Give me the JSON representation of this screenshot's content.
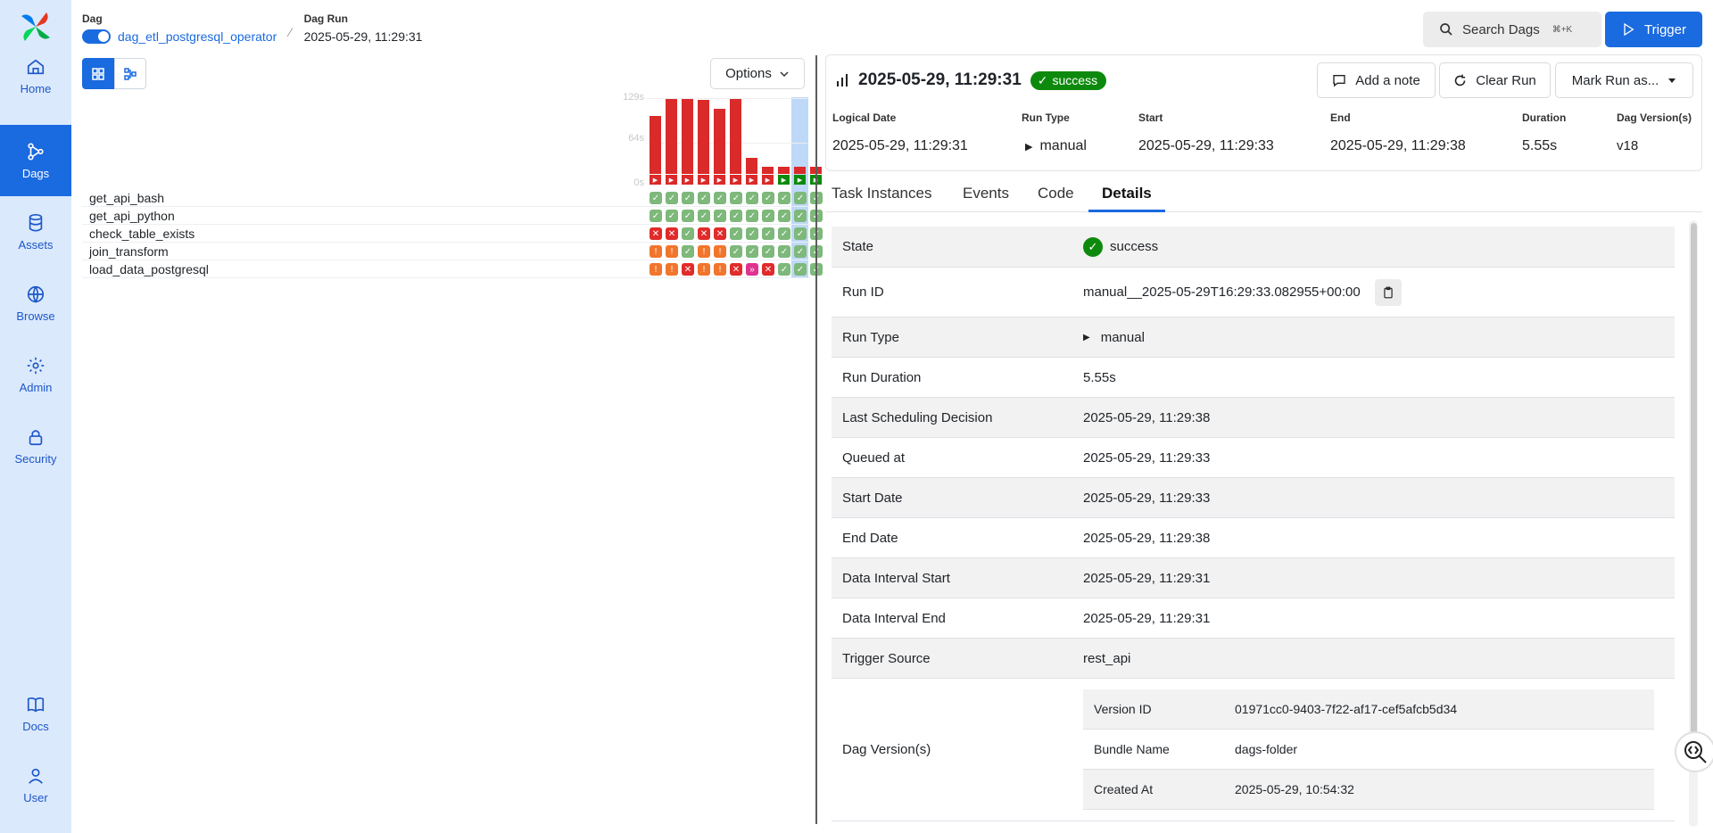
{
  "sidebar": {
    "items": [
      {
        "label": "Home"
      },
      {
        "label": "Dags"
      },
      {
        "label": "Assets"
      },
      {
        "label": "Browse"
      },
      {
        "label": "Admin"
      },
      {
        "label": "Security"
      },
      {
        "label": "Docs"
      },
      {
        "label": "User"
      }
    ]
  },
  "header": {
    "dag_label": "Dag",
    "dag_name": "dag_etl_postgresql_operator",
    "dagrun_label": "Dag Run",
    "dagrun_value": "2025-05-29, 11:29:31",
    "search_label": "Search Dags",
    "search_shortcut": "⌘+K",
    "trigger_label": "Trigger"
  },
  "grid": {
    "options_label": "Options",
    "y_ticks": [
      "129s",
      "64s",
      "0s"
    ],
    "run_durations_s": [
      98,
      127,
      128,
      126,
      111,
      127,
      27,
      12,
      12,
      12,
      12
    ],
    "run_states": [
      "failed",
      "failed",
      "failed",
      "failed",
      "failed",
      "failed",
      "failed",
      "failed",
      "success",
      "success",
      "success"
    ],
    "tasks": [
      {
        "name": "get_api_bash",
        "states": [
          "s",
          "s",
          "s",
          "s",
          "s",
          "s",
          "s",
          "s",
          "s",
          "s",
          "s"
        ]
      },
      {
        "name": "get_api_python",
        "states": [
          "s",
          "s",
          "s",
          "s",
          "s",
          "s",
          "s",
          "s",
          "s",
          "s",
          "s"
        ]
      },
      {
        "name": "check_table_exists",
        "states": [
          "f",
          "f",
          "s",
          "f",
          "f",
          "s",
          "s",
          "s",
          "s",
          "s",
          "s"
        ]
      },
      {
        "name": "join_transform",
        "states": [
          "u",
          "u",
          "s",
          "u",
          "u",
          "s",
          "s",
          "s",
          "s",
          "s",
          "s"
        ]
      },
      {
        "name": "load_data_postgresql",
        "states": [
          "u",
          "u",
          "f",
          "u",
          "u",
          "f",
          "k",
          "f",
          "s",
          "s",
          "s"
        ]
      }
    ]
  },
  "run": {
    "title": "2025-05-29, 11:29:31",
    "state": "success",
    "add_note_label": "Add a note",
    "clear_run_label": "Clear Run",
    "mark_run_label": "Mark Run as...",
    "meta": [
      {
        "label": "Logical Date",
        "value": "2025-05-29, 11:29:31"
      },
      {
        "label": "Run Type",
        "value": "manual"
      },
      {
        "label": "Start",
        "value": "2025-05-29, 11:29:33"
      },
      {
        "label": "End",
        "value": "2025-05-29, 11:29:38"
      },
      {
        "label": "Duration",
        "value": "5.55s"
      },
      {
        "label": "Dag Version(s)",
        "value": "v18"
      }
    ]
  },
  "tabs": [
    {
      "label": "Task Instances"
    },
    {
      "label": "Events"
    },
    {
      "label": "Code"
    },
    {
      "label": "Details"
    }
  ],
  "details": {
    "rows": [
      {
        "key": "State",
        "value": "success"
      },
      {
        "key": "Run ID",
        "value": "manual__2025-05-29T16:29:33.082955+00:00"
      },
      {
        "key": "Run Type",
        "value": "manual"
      },
      {
        "key": "Run Duration",
        "value": "5.55s"
      },
      {
        "key": "Last Scheduling Decision",
        "value": "2025-05-29, 11:29:38"
      },
      {
        "key": "Queued at",
        "value": "2025-05-29, 11:29:33"
      },
      {
        "key": "Start Date",
        "value": "2025-05-29, 11:29:33"
      },
      {
        "key": "End Date",
        "value": "2025-05-29, 11:29:38"
      },
      {
        "key": "Data Interval Start",
        "value": "2025-05-29, 11:29:31"
      },
      {
        "key": "Data Interval End",
        "value": "2025-05-29, 11:29:31"
      },
      {
        "key": "Trigger Source",
        "value": "rest_api"
      },
      {
        "key": "Dag Version(s)",
        "value": ""
      }
    ],
    "dag_version": [
      {
        "key": "Version ID",
        "value": "01971cc0-9403-7f22-af17-cef5afcb5d34"
      },
      {
        "key": "Bundle Name",
        "value": "dags-folder"
      },
      {
        "key": "Created At",
        "value": "2025-05-29, 10:54:32"
      }
    ]
  },
  "colors": {
    "accent": "#1a6ae0",
    "success": "#0d8a0d",
    "failed": "#e12b2b",
    "upstream_failed": "#f1752c",
    "skipped_icon": "#e0338f",
    "success_cell": "#7eb87b"
  }
}
